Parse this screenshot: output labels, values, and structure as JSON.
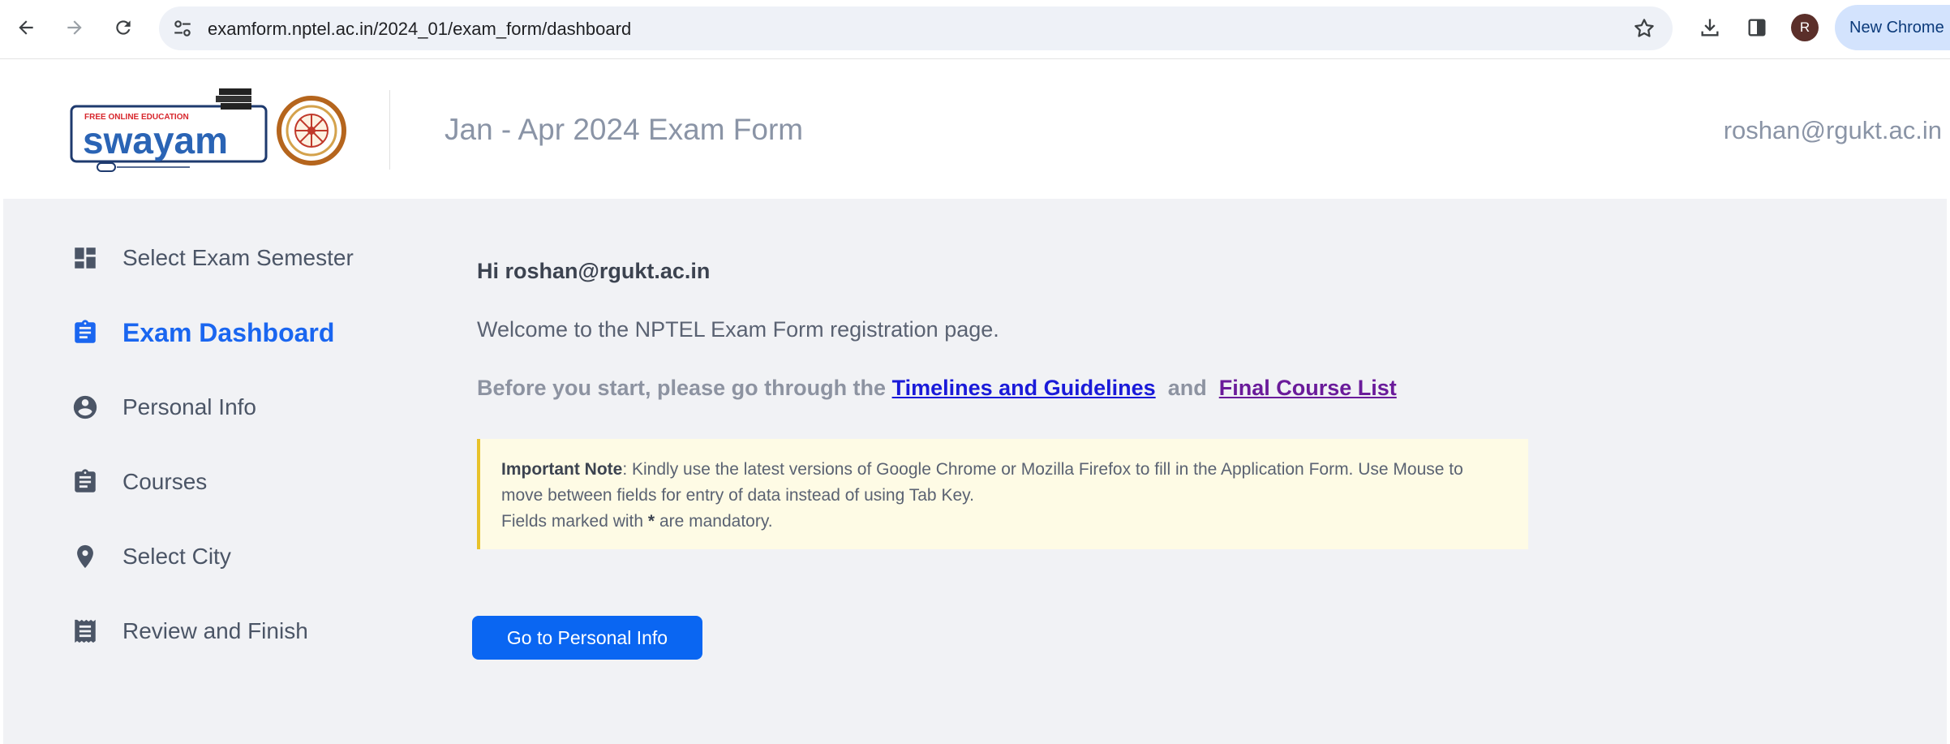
{
  "browser": {
    "url": "examform.nptel.ac.in/2024_01/exam_form/dashboard",
    "profile_initial": "R",
    "new_chrome_label": "New Chrome"
  },
  "header": {
    "title": "Jan - Apr 2024 Exam Form",
    "user_email": "roshan@rgukt.ac.in",
    "logo_tagline": "FREE ONLINE EDUCATION",
    "logo_name": "swayam"
  },
  "sidebar": {
    "items": [
      {
        "label": "Select Exam Semester",
        "icon": "dashboard-icon",
        "active": false
      },
      {
        "label": "Exam Dashboard",
        "icon": "clipboard-icon",
        "active": true
      },
      {
        "label": "Personal Info",
        "icon": "account-circle-icon",
        "active": false
      },
      {
        "label": "Courses",
        "icon": "clipboard-icon",
        "active": false
      },
      {
        "label": "Select City",
        "icon": "location-pin-icon",
        "active": false
      },
      {
        "label": "Review and Finish",
        "icon": "receipt-icon",
        "active": false
      }
    ]
  },
  "main": {
    "greeting": "Hi roshan@rgukt.ac.in",
    "welcome": "Welcome to the NPTEL Exam Form registration page.",
    "before_text": "Before you start, please go through the",
    "link_timelines": "Timelines and Guidelines",
    "and_text": "and",
    "link_course_list": "Final Course List",
    "note": {
      "label": "Important Note",
      "text": ": Kindly use the latest versions of Google Chrome or Mozilla Firefox to fill in the Application Form. Use Mouse to move between fields for entry of data instead of using Tab Key.",
      "mandatory_prefix": "Fields marked with",
      "mandatory_symbol": "*",
      "mandatory_suffix": "are mandatory."
    },
    "button_label": "Go to Personal Info"
  },
  "colors": {
    "accent": "#1a66f0",
    "button": "#0a66f2",
    "note_bg": "#fefbe5",
    "note_border": "#e8c22a",
    "main_bg": "#f1f2f5"
  }
}
